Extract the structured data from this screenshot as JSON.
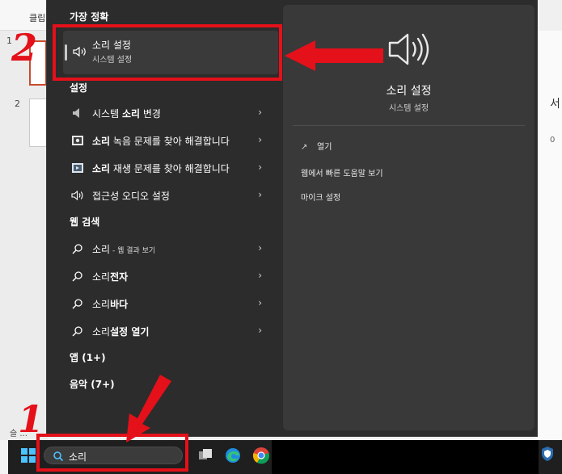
{
  "background_app": {
    "clipboard_label": "클립",
    "page_numbers": [
      "1",
      "2"
    ],
    "right_text": "서",
    "right_text2": "0",
    "status_text": "슬 ..."
  },
  "search_panel": {
    "best_match_title": "가장 정확",
    "best_match": {
      "title": "소리 설정",
      "subtitle": "시스템 설정",
      "icon": "speaker-icon"
    },
    "settings_title": "설정",
    "settings_items": [
      {
        "bold": "",
        "pre": "시스템 ",
        "strong": "소리",
        "post": " 변경",
        "icon": "speaker-small-icon"
      },
      {
        "pre": "",
        "strong": "소리",
        "post": " 녹음 문제를 찾아 해결합니다",
        "icon": "microphone-icon"
      },
      {
        "pre": "",
        "strong": "소리",
        "post": " 재생 문제를 찾아 해결합니다",
        "icon": "playback-icon"
      },
      {
        "pre": "접근성 오디오 설정",
        "strong": "",
        "post": "",
        "icon": "speaker-icon"
      }
    ],
    "web_title": "웹 검색",
    "web_items": [
      {
        "pre": "소리",
        "strong": "",
        "post": " - 웹 결과 보기",
        "small": true,
        "icon": "search-icon"
      },
      {
        "pre": "소리",
        "strong": "전자",
        "post": "",
        "icon": "search-icon"
      },
      {
        "pre": "소리",
        "strong": "바다",
        "post": "",
        "icon": "search-icon"
      },
      {
        "pre": "소리",
        "strong": "설정 열기",
        "post": "",
        "icon": "search-icon"
      }
    ],
    "apps_title": "앱 (1+)",
    "music_title": "음악 (7+)",
    "detail": {
      "title": "소리 설정",
      "subtitle": "시스템 설정",
      "actions": [
        "열기",
        "웹에서 빠른 도움말 보기",
        "마이크 설정"
      ]
    },
    "chevron": "›"
  },
  "taskbar": {
    "search_value": "소리",
    "icons": [
      "windows-start-icon",
      "task-view-icon",
      "edge-icon",
      "chrome-icon",
      "defender-icon"
    ]
  },
  "annotations": {
    "step1": "1",
    "step2": "2",
    "color": "#e4101a"
  }
}
